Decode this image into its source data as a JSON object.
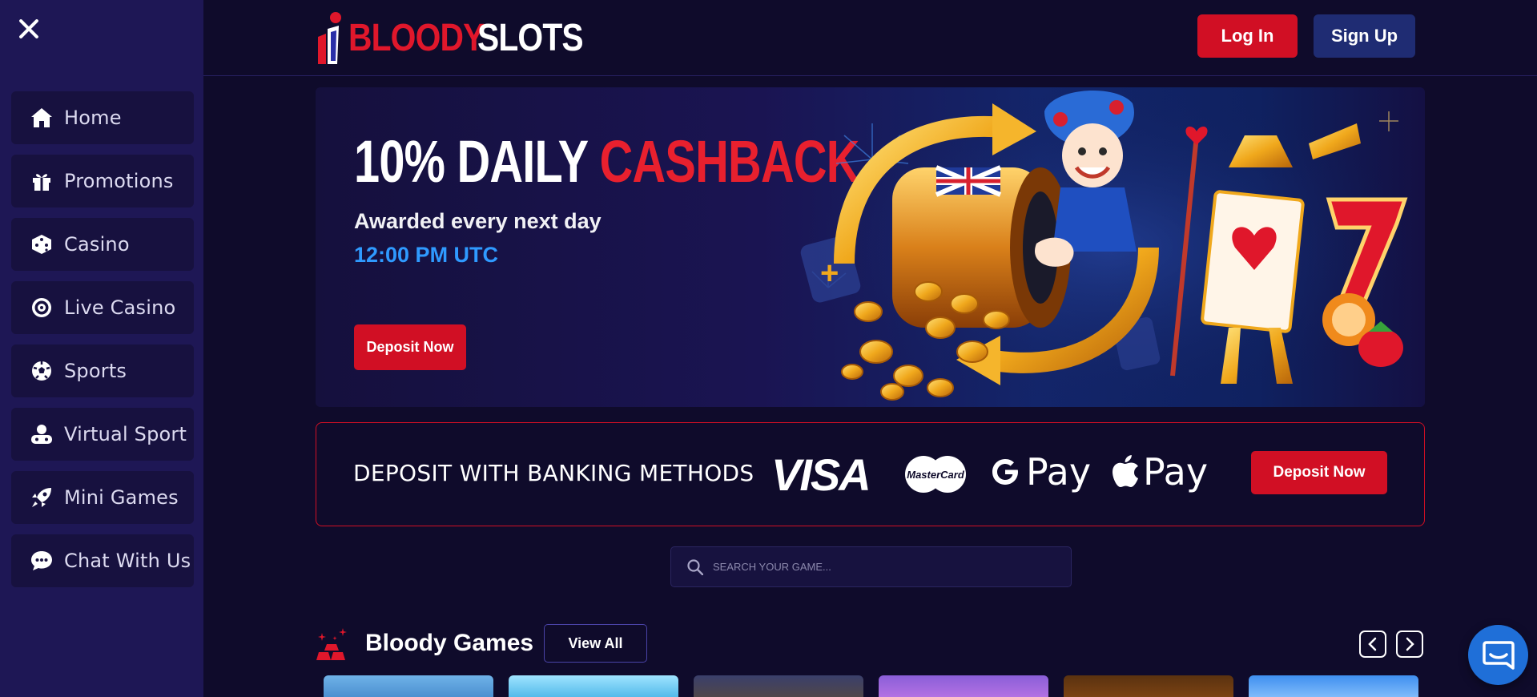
{
  "sidebar": {
    "items": [
      {
        "label": "Home",
        "icon": "home-icon"
      },
      {
        "label": "Promotions",
        "icon": "gift-icon"
      },
      {
        "label": "Casino",
        "icon": "dice-icon"
      },
      {
        "label": "Live Casino",
        "icon": "roulette-icon"
      },
      {
        "label": "Sports",
        "icon": "soccer-ball-icon"
      },
      {
        "label": "Virtual Sport",
        "icon": "virtual-sport-icon"
      },
      {
        "label": "Mini Games",
        "icon": "rocket-icon"
      },
      {
        "label": "Chat With Us",
        "icon": "chat-icon"
      }
    ]
  },
  "header": {
    "logo_part1": "BLOODY",
    "logo_part2": "SLOTS",
    "login_label": "Log In",
    "signup_label": "Sign Up"
  },
  "banner": {
    "title_white": "10% DAILY",
    "title_red": "CASHBACK",
    "subtitle": "Awarded every next day",
    "time": "12:00 PM UTC",
    "cta_label": "Deposit Now"
  },
  "banking": {
    "title": "DEPOSIT WITH BANKING METHODS",
    "visa": "VISA",
    "mastercard": "MasterCard",
    "gpay": "Pay",
    "applepay": "Pay",
    "cta_label": "Deposit Now"
  },
  "search": {
    "placeholder": "SEARCH YOUR GAME..."
  },
  "section": {
    "title": "Bloody Games",
    "view_all_label": "View All"
  },
  "colors": {
    "brand_red": "#d10f24",
    "sidebar_bg": "#1e1755",
    "page_bg": "#0f0b2b",
    "accent_blue": "#2f9aff"
  }
}
